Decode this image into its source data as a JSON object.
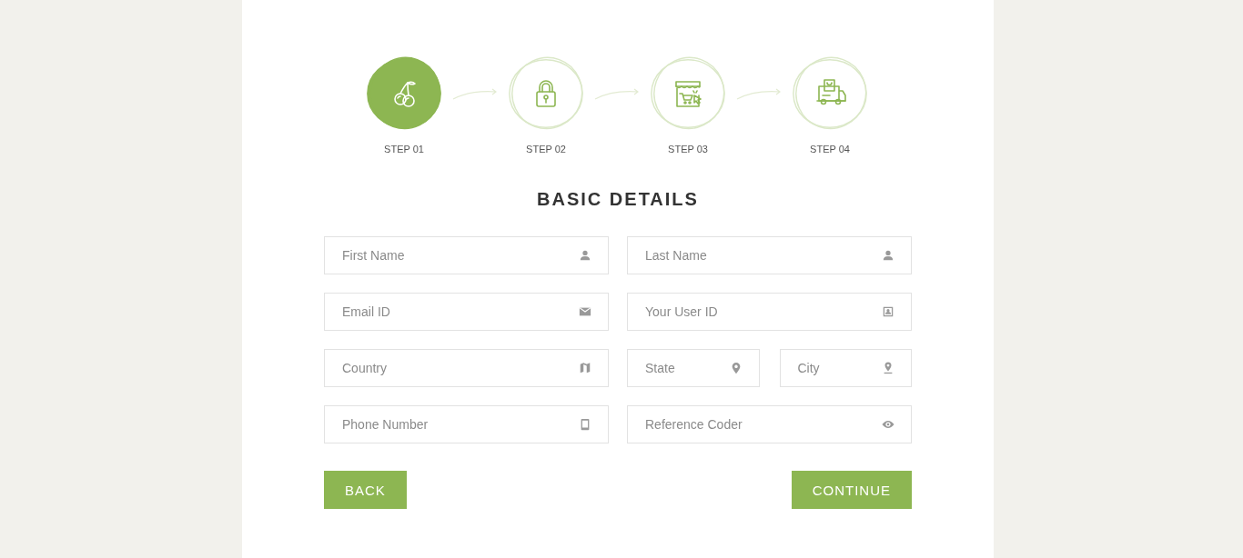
{
  "steps": [
    {
      "label": "STEP 01",
      "kind": "cherry",
      "selected": true
    },
    {
      "label": "STEP 02",
      "kind": "lock",
      "selected": false
    },
    {
      "label": "STEP 03",
      "kind": "shop",
      "selected": false
    },
    {
      "label": "STEP 04",
      "kind": "delivery",
      "selected": false
    }
  ],
  "title": "BASIC DETAILS",
  "rows": [
    {
      "left": {
        "placeholder": "First Name",
        "kind": "person"
      },
      "right": [
        {
          "placeholder": "Last Name",
          "kind": "person"
        }
      ]
    },
    {
      "left": {
        "placeholder": "Email ID",
        "kind": "mail"
      },
      "right": [
        {
          "placeholder": "Your User ID",
          "kind": "badge"
        }
      ]
    },
    {
      "left": {
        "placeholder": "Country",
        "kind": "map"
      },
      "right": [
        {
          "placeholder": "State",
          "kind": "pin"
        },
        {
          "placeholder": "City",
          "kind": "pinbase"
        }
      ]
    },
    {
      "left": {
        "placeholder": "Phone Number",
        "kind": "phone"
      },
      "right": [
        {
          "placeholder": "Reference Coder",
          "kind": "eye"
        }
      ]
    }
  ],
  "buttons": {
    "back": "BACK",
    "continue": "CONTINUE"
  }
}
